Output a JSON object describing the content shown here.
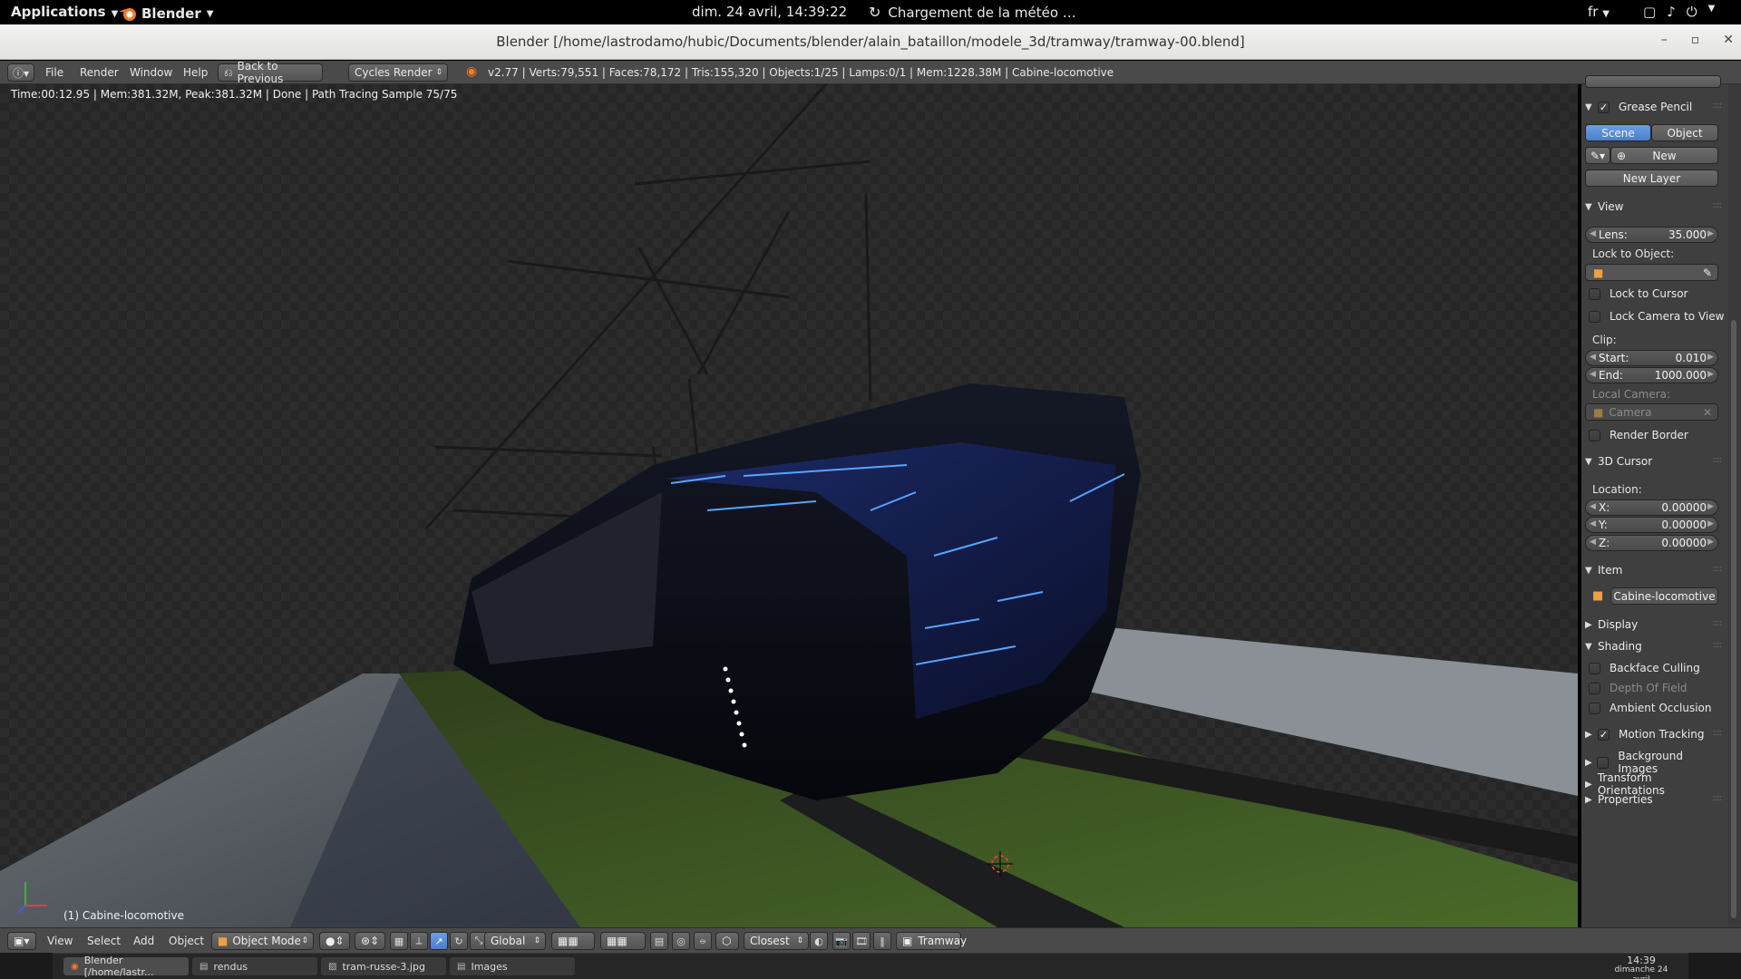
{
  "topbar": {
    "applications": "Applications",
    "blender": "Blender",
    "clock": "dim. 24 avril, 14:39:22",
    "weather": "Chargement de la météo …",
    "lang": "fr"
  },
  "window": {
    "title": "Blender [/home/lastrodamo/hubic/Documents/blender/alain_bataillon/modele_3d/tramway/tramway-00.blend]"
  },
  "info_header": {
    "menus": [
      "File",
      "Render",
      "Window",
      "Help"
    ],
    "back_button": "Back to Previous",
    "engine": "Cycles Render",
    "stats": "v2.77 | Verts:79,551 | Faces:78,172 | Tris:155,320 | Objects:1/25 | Lamps:0/1 | Mem:1228.38M | Cabine-locomotive"
  },
  "viewport": {
    "render_info": "Time:00:12.95 | Mem:381.32M, Peak:381.32M | Done | Path Tracing Sample 75/75",
    "object_label": "(1) Cabine-locomotive"
  },
  "npanel": {
    "grease_pencil": {
      "header": "Grease Pencil",
      "scene": "Scene",
      "object": "Object",
      "new": "New",
      "new_layer": "New Layer"
    },
    "view": {
      "header": "View",
      "lens_label": "Lens:",
      "lens_value": "35.000",
      "lock_to_object": "Lock to Object:",
      "lock_to_cursor": "Lock to Cursor",
      "lock_camera_to_view": "Lock Camera to View",
      "clip": "Clip:",
      "start_label": "Start:",
      "start_value": "0.010",
      "end_label": "End:",
      "end_value": "1000.000",
      "local_camera": "Local Camera:",
      "camera": "Camera",
      "render_border": "Render Border"
    },
    "cursor": {
      "header": "3D Cursor",
      "location": "Location:",
      "x_label": "X:",
      "x_value": "0.00000",
      "y_label": "Y:",
      "y_value": "0.00000",
      "z_label": "Z:",
      "z_value": "0.00000"
    },
    "item": {
      "header": "Item",
      "name": "Cabine-locomotive"
    },
    "display": {
      "header": "Display"
    },
    "shading": {
      "header": "Shading",
      "backface_culling": "Backface Culling",
      "depth_of_field": "Depth Of Field",
      "ambient_occlusion": "Ambient Occlusion"
    },
    "motion_tracking": "Motion Tracking",
    "background_images": "Background Images",
    "transform_orientations": "Transform Orientations",
    "properties": "Properties"
  },
  "view3d_header": {
    "menus": [
      "View",
      "Select",
      "Add",
      "Object"
    ],
    "mode": "Object Mode",
    "orientation": "Global",
    "snap": "Closest",
    "scene_name": "Tramway"
  },
  "taskbar": {
    "tasks": [
      "Blender [/home/lastr...",
      "rendus",
      "tram-russe-3.jpg",
      "Images"
    ],
    "time": "14:39",
    "date": "dimanche 24 avril"
  },
  "colors": {
    "accent_blue": "#5a8fd8",
    "panel_bg": "#3f3f3f",
    "header_bg": "#4a4a4a"
  }
}
